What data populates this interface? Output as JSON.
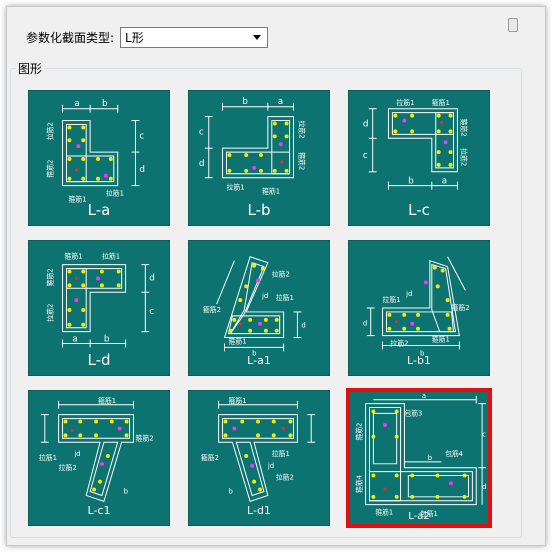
{
  "header": {
    "type_label": "参数化截面类型:",
    "selected_type": "L形"
  },
  "group": {
    "label": "图形"
  },
  "shapes": [
    {
      "caption": "L-a",
      "marks": {
        "a": "a",
        "b": "b",
        "c": "c",
        "d": "d",
        "lajin2": "拉筋2",
        "gujin2": "箍筋2",
        "lajin1": "拉筋1",
        "gujin1": "箍筋1"
      }
    },
    {
      "caption": "L-b",
      "marks": {
        "a": "a",
        "b": "b",
        "c": "c",
        "d": "d",
        "lajin2": "拉筋2",
        "gujin2": "箍筋2",
        "lajin1": "拉筋1",
        "gujin1": "箍筋1"
      }
    },
    {
      "caption": "L-c",
      "marks": {
        "a": "a",
        "b": "b",
        "c": "c",
        "d": "d",
        "lajin1": "拉筋1",
        "gujin1": "箍筋1",
        "gujin2": "箍筋2",
        "lajin2": "拉筋2"
      }
    },
    {
      "caption": "L-d",
      "marks": {
        "a": "a",
        "b": "b",
        "c": "c",
        "d": "d",
        "gujin1": "箍筋1",
        "lajin1": "拉筋1",
        "gujin2": "箍筋2",
        "lajin2": "拉筋2"
      }
    },
    {
      "caption": "L-a1",
      "marks": {
        "lajin2": "拉筋2",
        "jd": "jd",
        "lajin1": "拉筋1",
        "gujin2": "箍筋2",
        "gujin1": "箍筋1",
        "b": "b",
        "d": "d"
      }
    },
    {
      "caption": "L-b1",
      "marks": {
        "lajin1": "拉筋1",
        "gujin2": "箍筋2",
        "jd": "jd",
        "gujin1": "箍筋1",
        "lajin2": "拉筋2",
        "b": "b",
        "d": "d"
      }
    },
    {
      "caption": "L-c1",
      "marks": {
        "gujin1": "箍筋1",
        "lajin1": "拉筋1",
        "jd": "jd",
        "lajin2": "拉筋2",
        "gujin2": "箍筋2",
        "b": "b"
      }
    },
    {
      "caption": "L-d1",
      "marks": {
        "gujin1": "箍筋1",
        "lajin1": "拉筋1",
        "jd": "jd",
        "lajin2": "拉筋2",
        "gujin2": "箍筋2",
        "b": "b"
      }
    },
    {
      "caption": "L-a2",
      "marks": {
        "baojin3": "包筋3",
        "gujin2": "箍筋2",
        "baojin4": "包筋4",
        "gujin4": "箍筋4",
        "gujin1": "箍筋1",
        "baojin1": "包筋1",
        "a": "a",
        "b": "b",
        "c": "c",
        "d": "d"
      }
    }
  ],
  "colors": {
    "tile_bg": "#0c7370",
    "line": "#ffffff",
    "bar_yellow": "#f2ee00",
    "bar_magenta": "#ff30ff",
    "bar_red": "#ff2020",
    "selected_border": "#e01010"
  }
}
